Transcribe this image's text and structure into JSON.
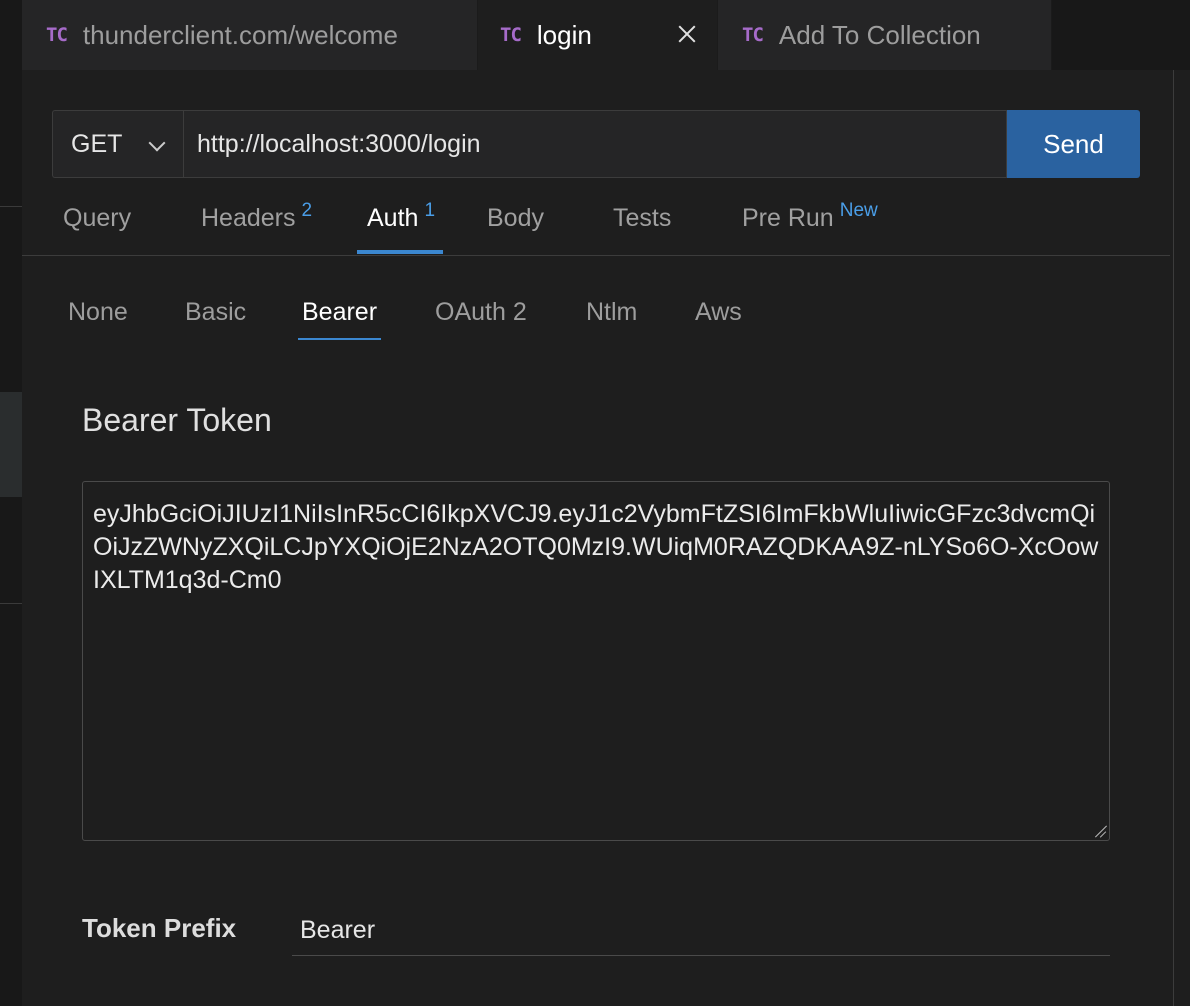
{
  "tabs": [
    {
      "icon": "TC",
      "label": "thunderclient.com/welcome"
    },
    {
      "icon": "TC",
      "label": "login"
    },
    {
      "icon": "TC",
      "label": "Add To Collection"
    }
  ],
  "request": {
    "method": "GET",
    "url": "http://localhost:3000/login",
    "send_label": "Send"
  },
  "request_tabs": [
    {
      "label": "Query",
      "badge": ""
    },
    {
      "label": "Headers",
      "badge": "2"
    },
    {
      "label": "Auth",
      "badge": "1"
    },
    {
      "label": "Body",
      "badge": ""
    },
    {
      "label": "Tests",
      "badge": ""
    },
    {
      "label": "Pre Run",
      "badge": "New"
    }
  ],
  "auth_types": [
    "None",
    "Basic",
    "Bearer",
    "OAuth 2",
    "Ntlm",
    "Aws"
  ],
  "auth": {
    "title": "Bearer Token",
    "token": "eyJhbGciOiJIUzI1NiIsInR5cCI6IkpXVCJ9.eyJ1c2VybmFtZSI6ImFkbWluIiwicGFzc3dvcmQiOiJzZWNyZXQiLCJpYXQiOjE2NzA2OTQ0MzI9.WUiqM0RAZQDKAA9Z-nLYSo6O-XcOowIXLTM1q3d-Cm0",
    "prefix_label": "Token Prefix",
    "prefix_value": "Bearer"
  },
  "colors": {
    "accent": "#3b87d0",
    "send_button": "#2a62a0",
    "badge": "#4a9ee8",
    "tc_icon": "#a66bc9"
  }
}
